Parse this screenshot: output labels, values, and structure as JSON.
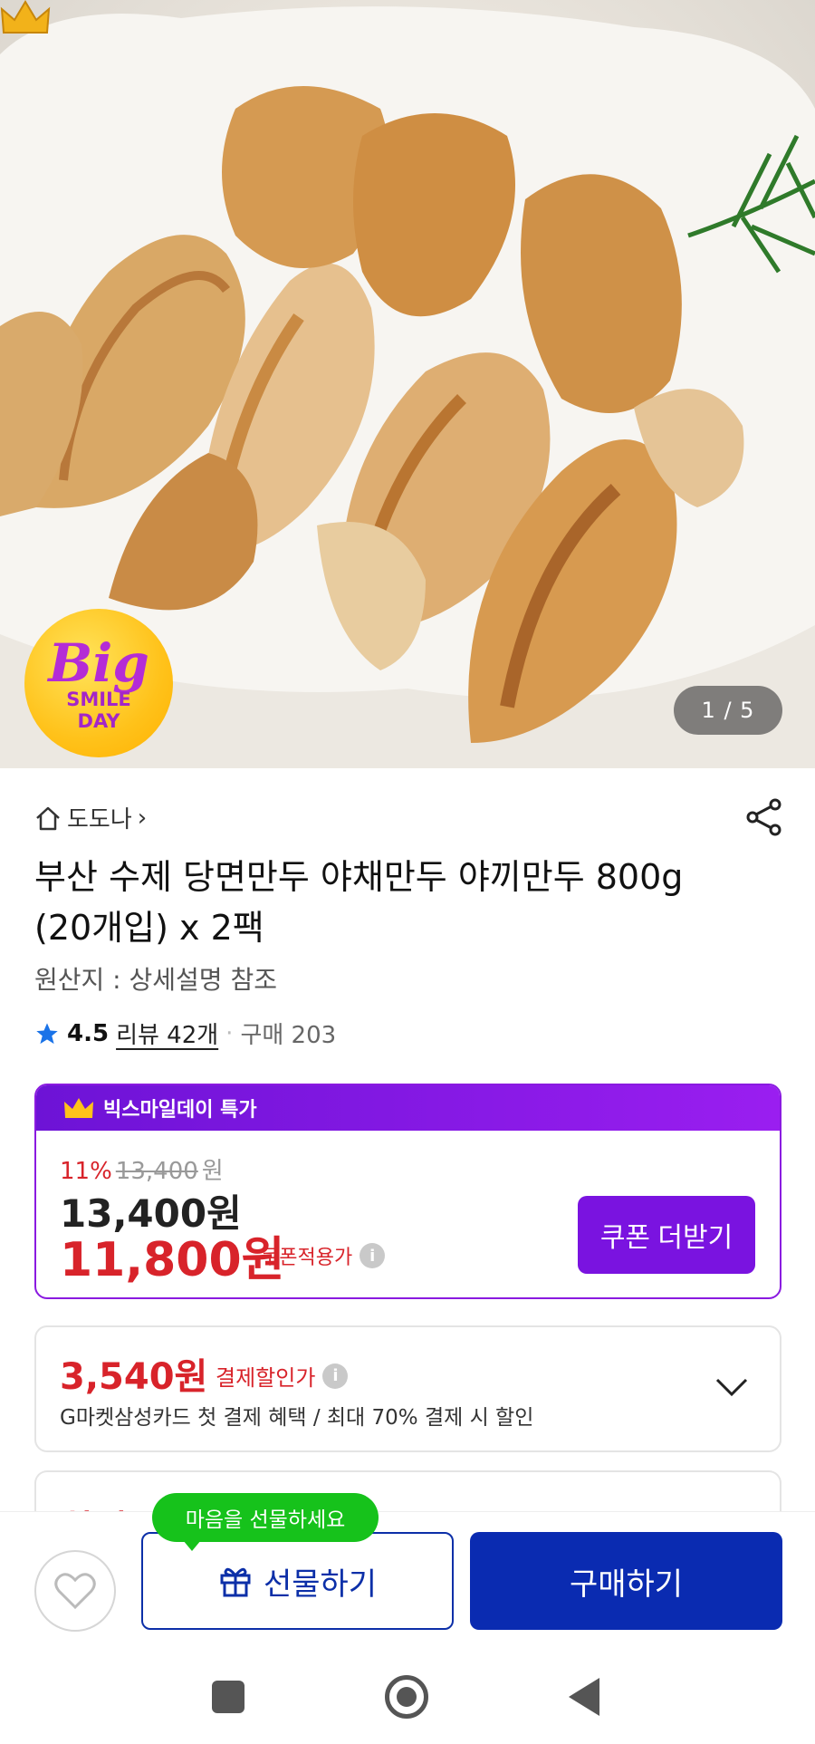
{
  "hero": {
    "badge": {
      "line1": "Big",
      "line2": "SMILE",
      "line3": "DAY"
    },
    "counter": "1 / 5"
  },
  "store": {
    "name": "도도나",
    "chevron": "›"
  },
  "product": {
    "title": "부산 수제 당면만두 야채만두 야끼만두 800g (20개입) x 2팩",
    "origin": "원산지 : 상세설명 참조",
    "rating": "4.5",
    "reviews": "리뷰 42개",
    "separator": "·",
    "purchases": "구매 203"
  },
  "promo": {
    "header": "빅스마일데이 특가",
    "discount_pct": "11%",
    "original_price": "13,400",
    "original_unit": "원",
    "price": "13,400원",
    "coupon_price": "11,800원",
    "coupon_label": "쿠폰적용가",
    "coupon_button": "쿠폰 더받기"
  },
  "card_discount": {
    "amount": "3,540원",
    "label": "결제할인가",
    "description": "G마켓삼성카드 첫 결제 혜택 / 최대 70% 결제 시 할인"
  },
  "partial_card": {
    "text": "최대 94"
  },
  "bottom": {
    "tooltip": "마음을 선물하세요",
    "gift_button": "선물하기",
    "buy_button": "구매하기"
  },
  "colors": {
    "brand_purple": "#7a13e0",
    "price_red": "#d8232a",
    "buy_blue": "#0a2bb1",
    "tooltip_green": "#16c21b"
  },
  "icons": [
    "crown-icon",
    "home-icon",
    "share-icon",
    "star-icon",
    "info-icon",
    "chevron-down-icon",
    "heart-icon",
    "gift-icon",
    "recent-apps-icon",
    "home-nav-icon",
    "back-nav-icon"
  ]
}
